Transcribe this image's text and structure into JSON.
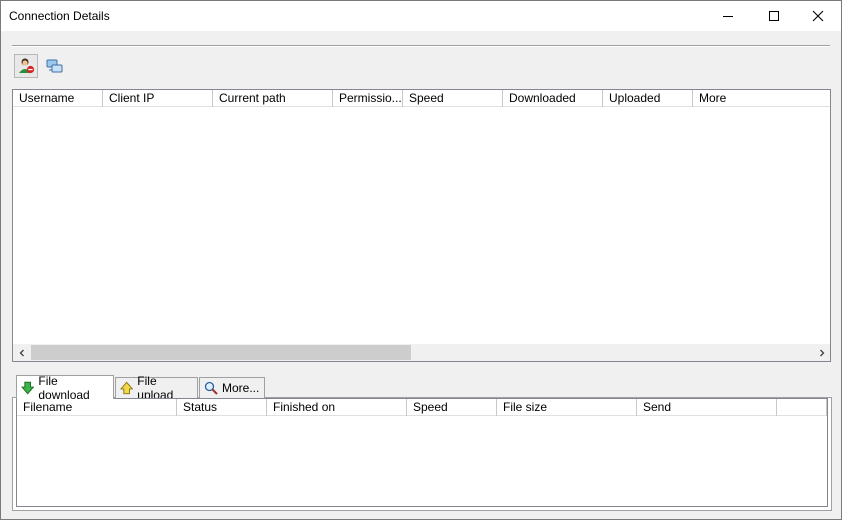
{
  "window": {
    "title": "Connection Details"
  },
  "toolbar": {
    "kick_icon": "kick-user-icon",
    "network_icon": "network-icon"
  },
  "connections": {
    "columns": [
      "Username",
      "Client IP",
      "Current path",
      "Permissio...",
      "Speed",
      "Downloaded",
      "Uploaded",
      "More"
    ],
    "rows": []
  },
  "tabs": [
    {
      "label": "File download",
      "icon": "download-arrow-icon",
      "active": true
    },
    {
      "label": "File upload",
      "icon": "upload-arrow-icon",
      "active": false
    },
    {
      "label": "More...",
      "icon": "magnifier-icon",
      "active": false
    }
  ],
  "transfers": {
    "columns": [
      "Filename",
      "Status",
      "Finished on",
      "Speed",
      "File size",
      "Send"
    ],
    "rows": []
  },
  "colors": {
    "titlebar": "#ffffff",
    "window_bg": "#f0f0f0",
    "border": "#828790"
  }
}
